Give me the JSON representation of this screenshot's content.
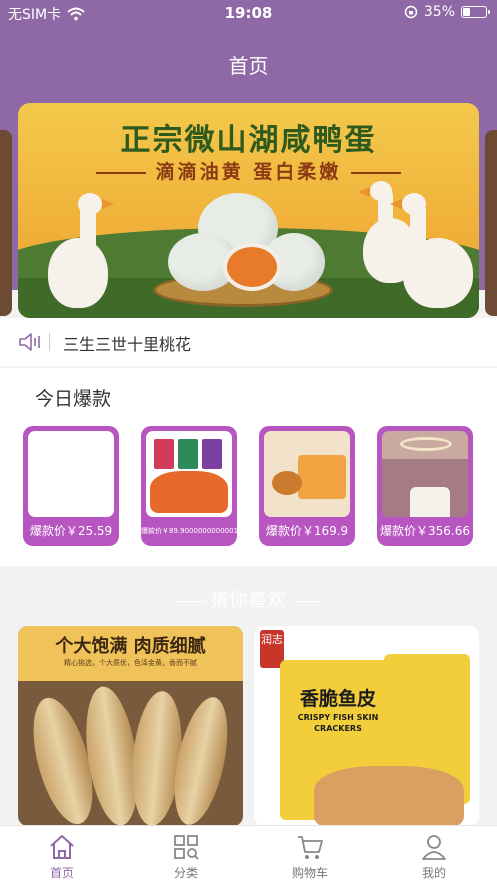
{
  "status_bar": {
    "carrier": "无SIM卡",
    "time": "19:08",
    "battery": "35%",
    "battery_level": 0.35
  },
  "nav": {
    "title": "首页"
  },
  "banner": {
    "title": "正宗微山湖咸鸭蛋",
    "subtitle": "滴滴油黄 蛋白柔嫩"
  },
  "notice": {
    "text": "三生三世十里桃花"
  },
  "hot": {
    "heading": "今日爆款",
    "items": [
      {
        "price": "爆款价￥25.59"
      },
      {
        "price": "爆款价￥89.9000000000001"
      },
      {
        "price": "爆款价￥169.9"
      },
      {
        "price": "爆款价￥356.66"
      }
    ]
  },
  "guess": {
    "heading": "猜你喜欢"
  },
  "products": [
    {
      "title": "个大饱满 肉质细腻",
      "desc": "精心挑选，个大质优，色泽金黄，香而不腻"
    },
    {
      "brand": "润志",
      "title": "香脆鱼皮",
      "english": "CRISPY FISH SKIN CRACKERS"
    }
  ],
  "tabbar": {
    "items": [
      {
        "label": "首页",
        "icon": "home-icon"
      },
      {
        "label": "分类",
        "icon": "category-icon"
      },
      {
        "label": "购物车",
        "icon": "cart-icon"
      },
      {
        "label": "我的",
        "icon": "profile-icon"
      }
    ]
  },
  "colors": {
    "accent": "#8f69a5",
    "card": "#b856c1"
  }
}
